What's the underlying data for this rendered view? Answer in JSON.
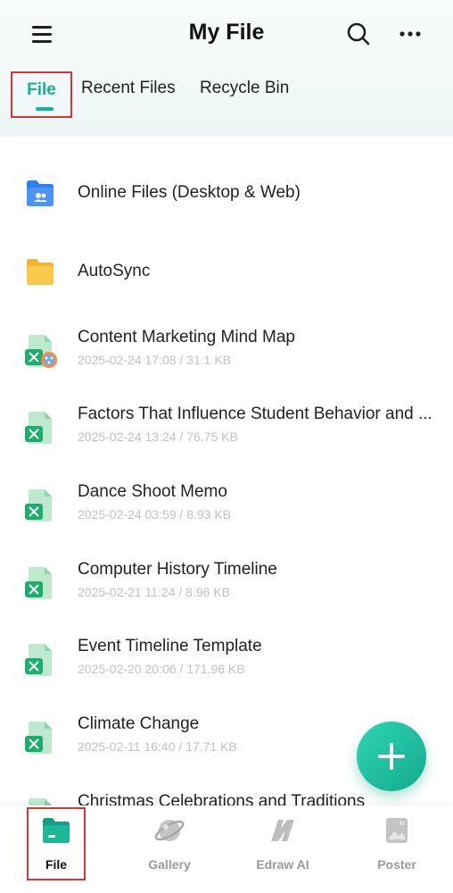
{
  "header": {
    "title": "My File",
    "tabs": [
      {
        "label": "File",
        "active": true
      },
      {
        "label": "Recent Files",
        "active": false
      },
      {
        "label": "Recycle Bin",
        "active": false
      }
    ]
  },
  "files": [
    {
      "name": "Online Files (Desktop & Web)",
      "meta": "",
      "icon": "cloud-folder-icon"
    },
    {
      "name": "AutoSync",
      "meta": "",
      "icon": "folder-icon"
    },
    {
      "name": "Content Marketing Mind Map",
      "meta": "2025-02-24 17:08 / 31.1 KB",
      "icon": "mindmap-file-icon"
    },
    {
      "name": "Factors That Influence Student Behavior and ...",
      "meta": "2025-02-24 13:24 / 76.75 KB",
      "icon": "edraw-file-icon"
    },
    {
      "name": "Dance Shoot Memo",
      "meta": "2025-02-24 03:59 / 8.93 KB",
      "icon": "edraw-file-icon"
    },
    {
      "name": "Computer History Timeline",
      "meta": "2025-02-21 11:24 / 8.96 KB",
      "icon": "edraw-file-icon"
    },
    {
      "name": "Event Timeline Template",
      "meta": "2025-02-20 20:06 / 171.96 KB",
      "icon": "edraw-file-icon"
    },
    {
      "name": "Climate Change",
      "meta": "2025-02-11 16:40 / 17.71 KB",
      "icon": "edraw-file-icon"
    },
    {
      "name": "Christmas Celebrations and Traditions",
      "meta": "",
      "icon": "edraw-file-icon"
    }
  ],
  "bottom_nav": [
    {
      "label": "File",
      "active": true,
      "icon": "file-folder-icon"
    },
    {
      "label": "Gallery",
      "active": false,
      "icon": "gallery-planet-icon"
    },
    {
      "label": "Edraw AI",
      "active": false,
      "icon": "edraw-ai-icon"
    },
    {
      "label": "Poster",
      "active": false,
      "icon": "poster-icon"
    }
  ],
  "colors": {
    "accent": "#16b395",
    "highlight_box": "#d9343a",
    "folder_blue": "#2f7ff0",
    "folder_yellow": "#f6c33a"
  }
}
